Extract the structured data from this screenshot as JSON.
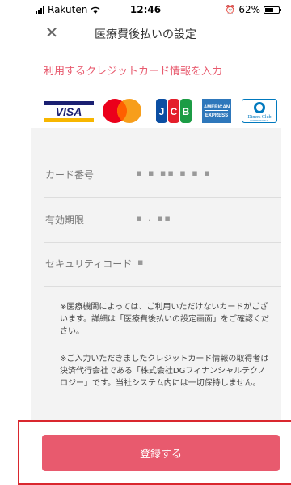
{
  "status_bar": {
    "carrier": "Rakuten",
    "time": "12:46",
    "battery_percent": "62%",
    "battery_level": 0.62
  },
  "nav": {
    "title": "医療費後払いの設定",
    "close_icon": "close-icon"
  },
  "section": {
    "title": "利用するクレジットカード情報を入力"
  },
  "brands": [
    "VISA",
    "Mastercard",
    "JCB",
    "AMERICAN EXPRESS",
    "Diners Club INTERNATIONAL"
  ],
  "form": {
    "card_number": {
      "label": "カード番号",
      "value": "▪ ▪ ▪▪ ▪ ▪ ▪"
    },
    "expiry": {
      "label": "有効期限",
      "value": "▪ . ▪▪"
    },
    "security_code": {
      "label": "セキュリティコード",
      "value": "▪"
    }
  },
  "notes": [
    "※医療機関によっては、ご利用いただけないカードがございます。詳細は「医療費後払いの設定画面」をご確認ください。",
    "※ご入力いただきましたクレジットカード情報の取得者は決済代行会社である「株式会社DGフィナンシャルテクノロジー」です。当社システム内には一切保持しません。"
  ],
  "actions": {
    "register_label": "登録する"
  },
  "colors": {
    "accent": "#e85a6e",
    "highlight_border": "#d9272e",
    "panel_bg": "#f3f3f3"
  }
}
